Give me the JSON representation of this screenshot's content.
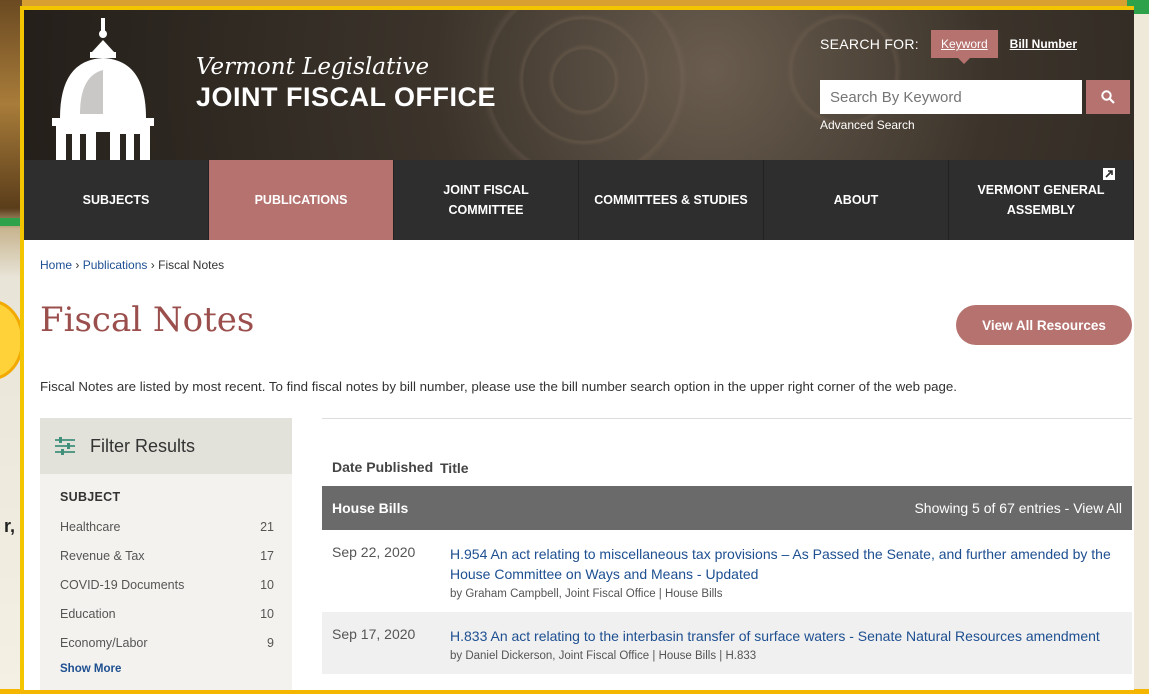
{
  "header": {
    "brand_line1": "Vermont Legislative",
    "brand_line2": "JOINT FISCAL OFFICE",
    "search_for_label": "SEARCH FOR:",
    "search_modes": [
      "Keyword",
      "Bill Number"
    ],
    "search_placeholder": "Search By Keyword",
    "advanced_search": "Advanced Search"
  },
  "nav": {
    "items": [
      "SUBJECTS",
      "PUBLICATIONS",
      "JOINT FISCAL COMMITTEE",
      "COMMITTEES & STUDIES",
      "ABOUT",
      "VERMONT GENERAL ASSEMBLY"
    ],
    "active": "PUBLICATIONS"
  },
  "breadcrumb": {
    "home": "Home",
    "sep": "›",
    "publications": "Publications",
    "current": "Fiscal Notes"
  },
  "page": {
    "title": "Fiscal Notes",
    "view_all_button": "View All Resources",
    "intro": "Fiscal Notes are listed by most recent. To find fiscal notes by bill number, please use the bill number search option in the upper right corner of the web page."
  },
  "sidebar": {
    "heading": "Filter Results",
    "subject_heading": "SUBJECT",
    "filters": [
      {
        "label": "Healthcare",
        "count": "21"
      },
      {
        "label": "Revenue & Tax",
        "count": "17"
      },
      {
        "label": "COVID-19 Documents",
        "count": "10"
      },
      {
        "label": "Education",
        "count": "10"
      },
      {
        "label": "Economy/Labor",
        "count": "9"
      }
    ],
    "show_more": "Show More"
  },
  "table": {
    "col_date": "Date Published",
    "col_title": "Title",
    "group_name": "House Bills",
    "group_status": "Showing 5 of 67 entries - View All",
    "rows": [
      {
        "date": "Sep 22, 2020",
        "title": "H.954 An act relating to miscellaneous tax provisions – As Passed the Senate, and further amended by the House Committee on Ways and Means - Updated",
        "meta": "by Graham Campbell, Joint Fiscal Office | House Bills"
      },
      {
        "date": "Sep 17, 2020",
        "title": "H.833 An act relating to the interbasin transfer of surface waters - Senate Natural Resources amendment",
        "meta": "by Daniel Dickerson, Joint Fiscal Office | House Bills | H.833"
      }
    ]
  },
  "background": {
    "partial_text": "r,"
  },
  "colors": {
    "accent": "#b5726f",
    "title": "#9a4f4c",
    "link": "#1d4f91",
    "nav": "#2e2e2e"
  }
}
